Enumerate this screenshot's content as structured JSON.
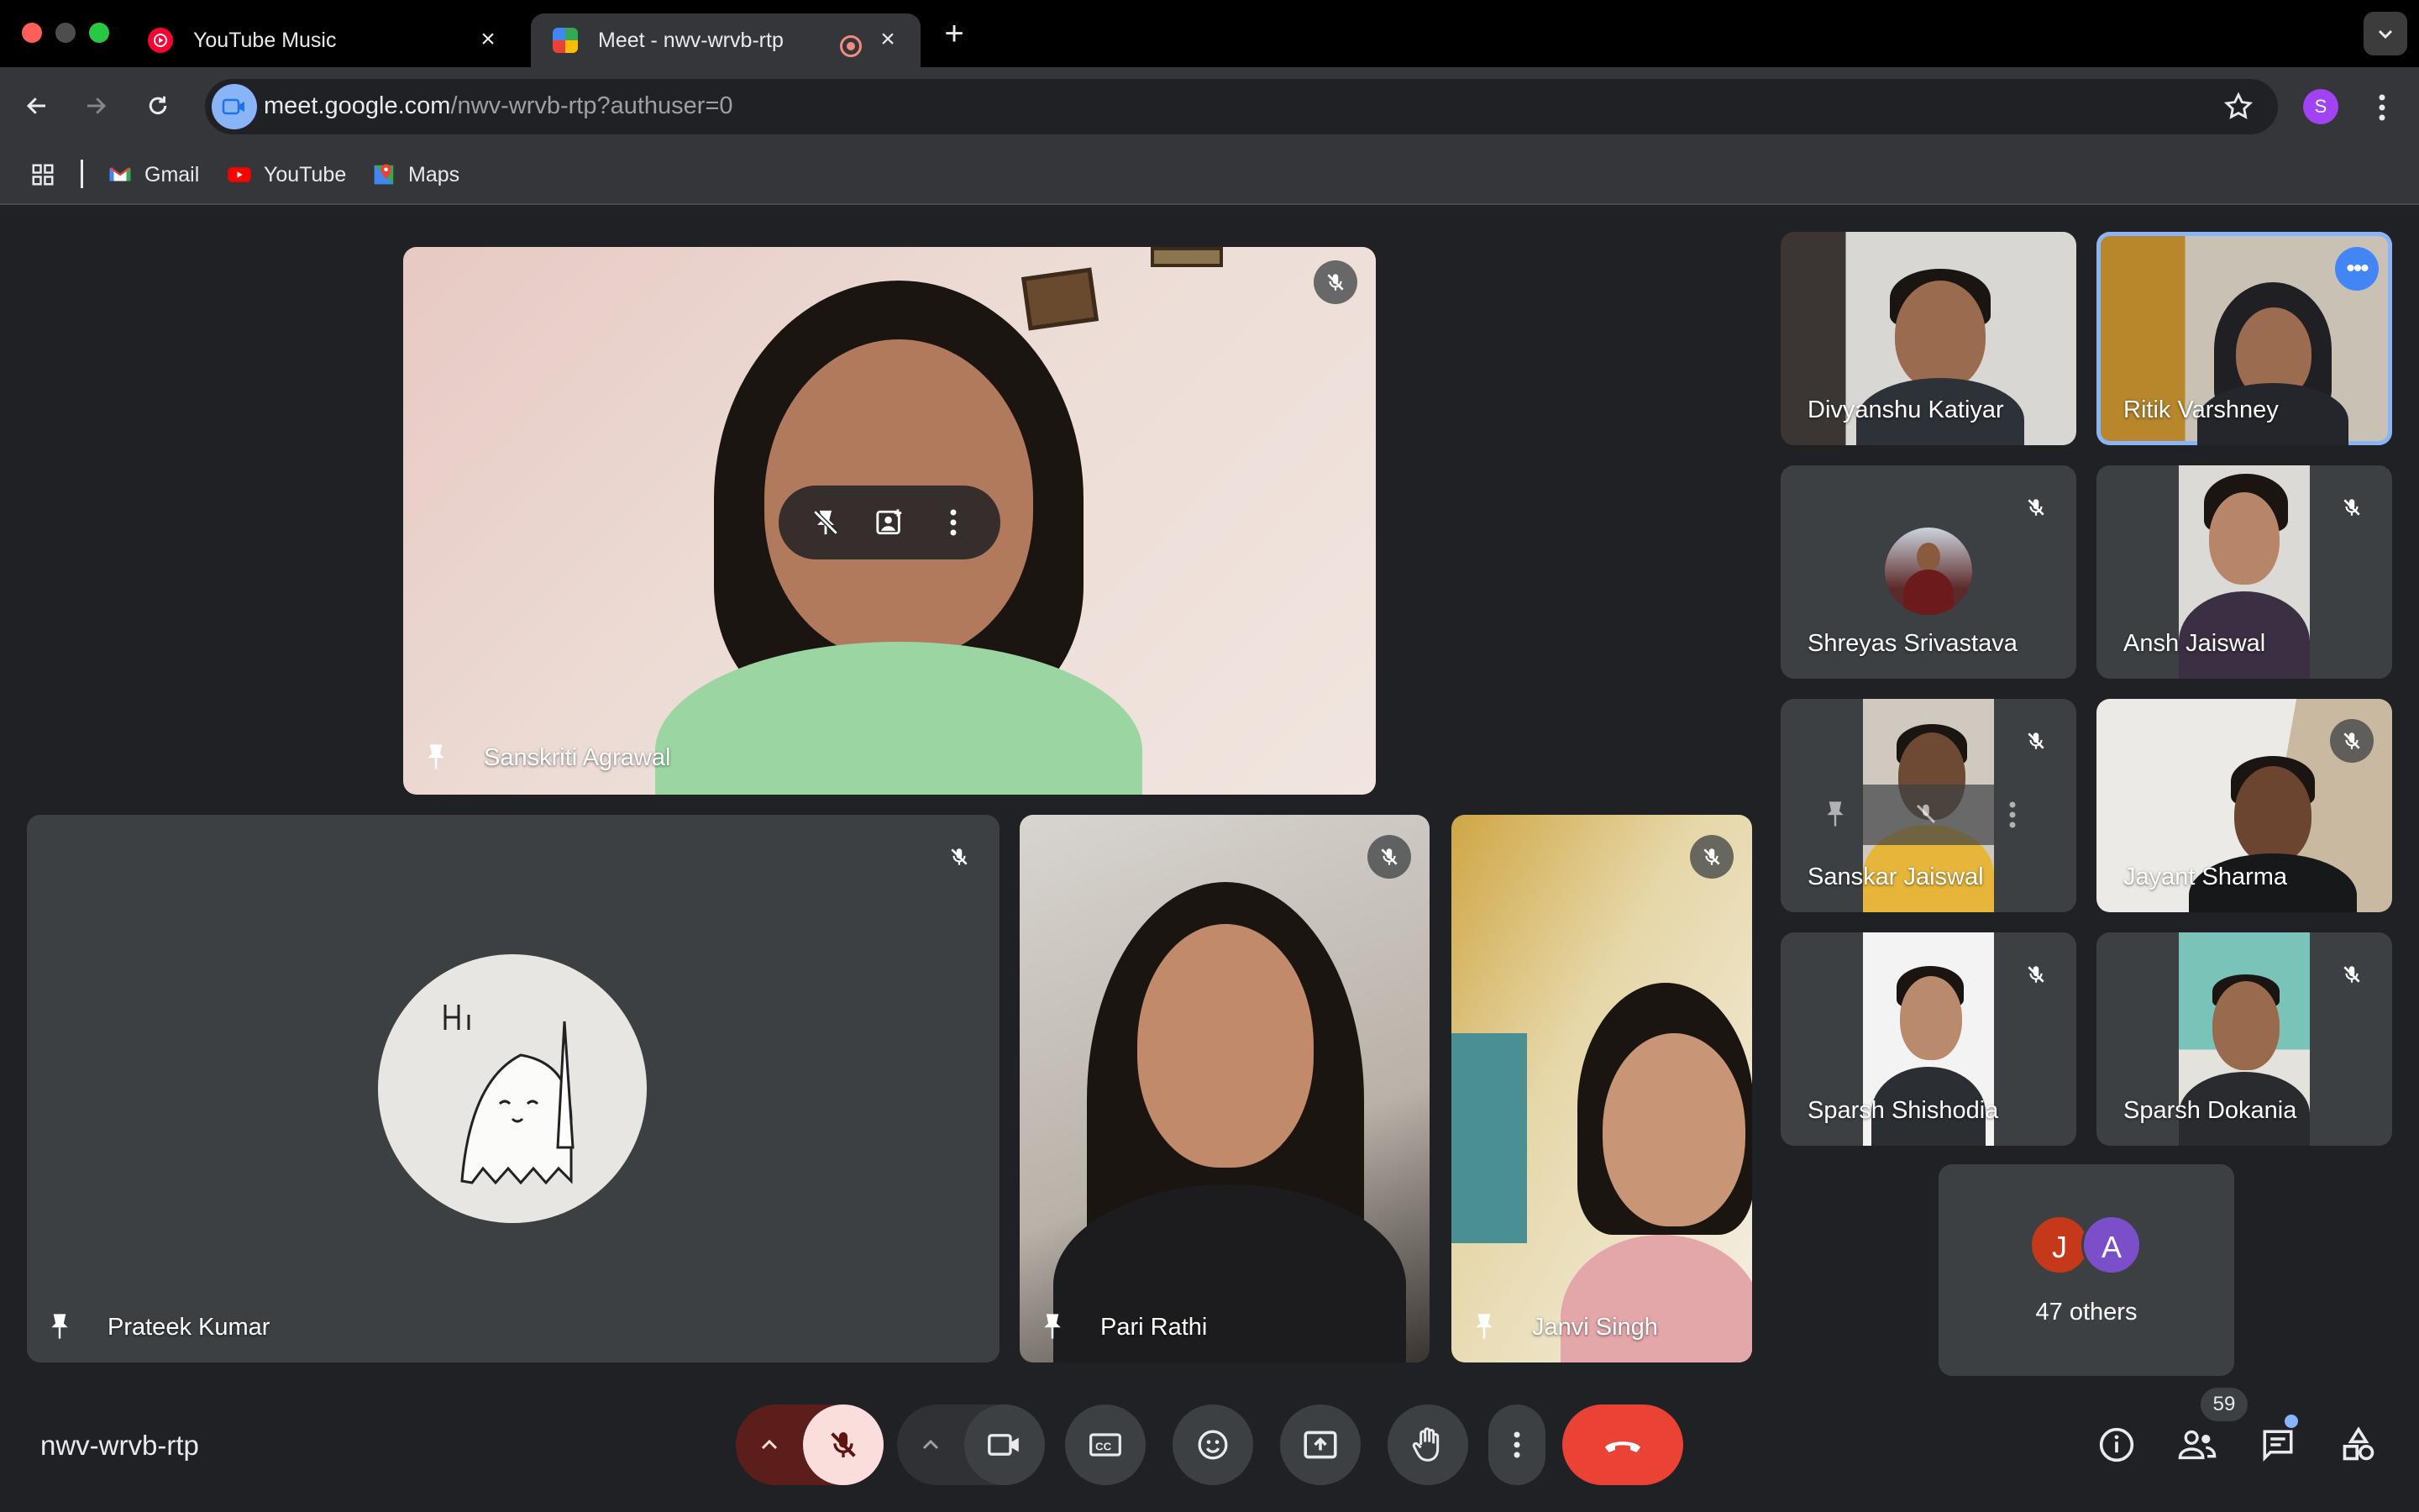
{
  "browser": {
    "tabs": [
      {
        "title": "YouTube Music",
        "active": false
      },
      {
        "title": "Meet - nwv-wrvb-rtp",
        "active": true
      }
    ],
    "url_host": "meet.google.com",
    "url_path": "/nwv-wrvb-rtp?authuser=0",
    "profile_initial": "S",
    "bookmarks": [
      {
        "label": "Gmail"
      },
      {
        "label": "YouTube"
      },
      {
        "label": "Maps"
      }
    ]
  },
  "meet": {
    "meeting_code": "nwv-wrvb-rtp",
    "participant_count": "59",
    "pinned": [
      {
        "name": "Sanskriti Agrawal",
        "muted": true
      },
      {
        "name": "Prateek Kumar",
        "muted": true
      },
      {
        "name": "Pari Rathi",
        "muted": true
      },
      {
        "name": "Janvi Singh",
        "muted": true
      }
    ],
    "grid": [
      {
        "name": "Divyanshu Katiyar",
        "muted": false
      },
      {
        "name": "Ritik Varshney",
        "muted": false,
        "speaking": true
      },
      {
        "name": "Shreyas Srivastava",
        "muted": true
      },
      {
        "name": "Ansh Jaiswal",
        "muted": true
      },
      {
        "name": "Sanskar Jaiswal",
        "muted": true
      },
      {
        "name": "Jayant Sharma",
        "muted": true
      },
      {
        "name": "Sparsh Shishodia",
        "muted": true
      },
      {
        "name": "Sparsh Dokania",
        "muted": true
      }
    ],
    "others": {
      "label": "47 others",
      "avatars": [
        {
          "initial": "J",
          "color": "#c5391a"
        },
        {
          "initial": "A",
          "color": "#7b4fc9"
        }
      ]
    },
    "accent": "#8ab4f8",
    "leave_color": "#ea4335"
  }
}
